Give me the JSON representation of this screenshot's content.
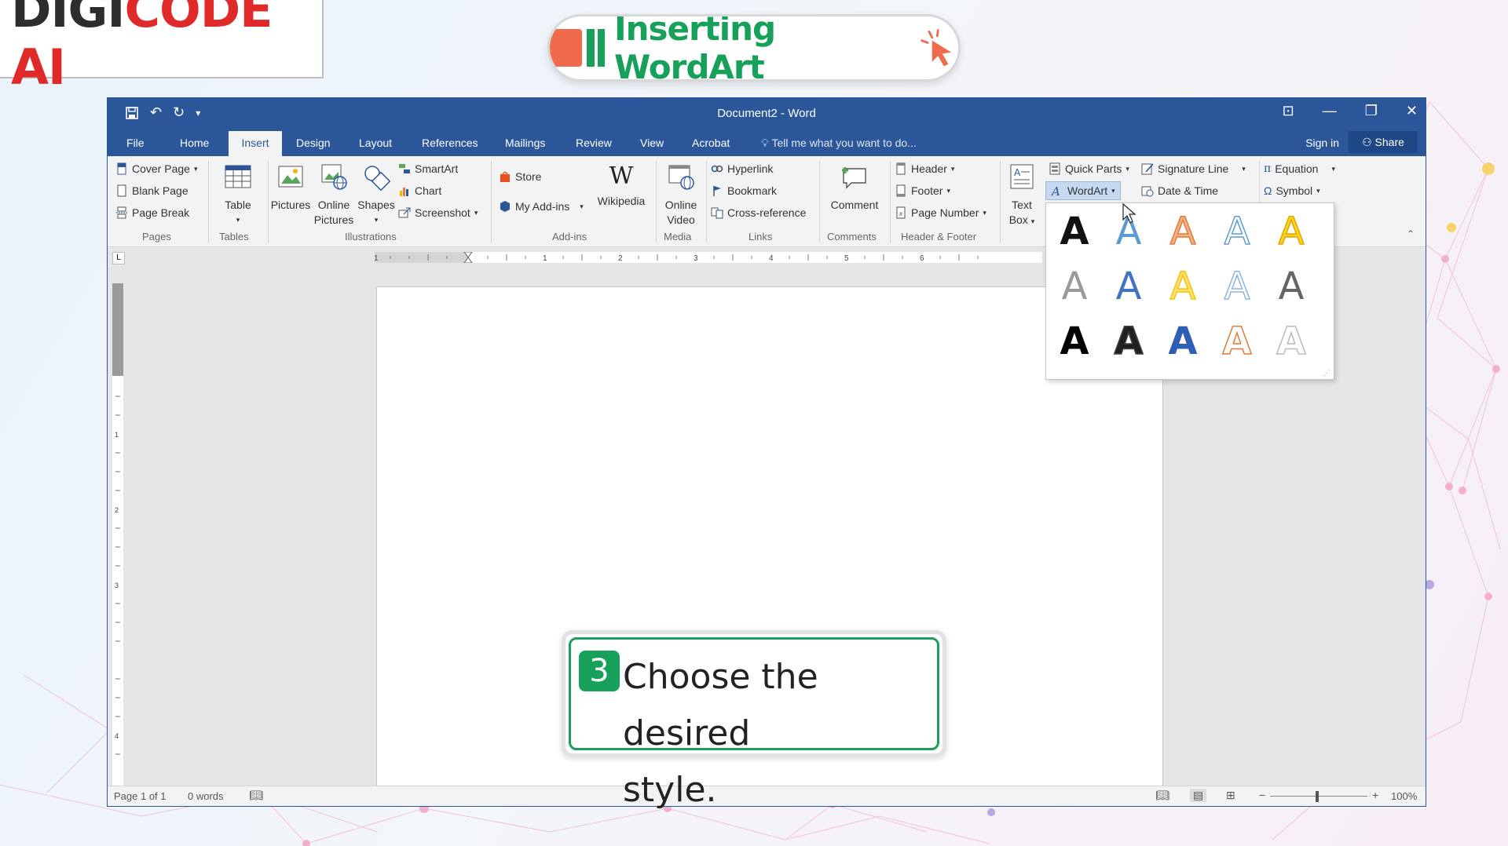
{
  "brand": {
    "part1": "DIGI",
    "part2": "CODE AI"
  },
  "lesson_title": "Inserting WordArt",
  "window": {
    "title": "Document2 - Word",
    "qat_icons": [
      "save-icon",
      "undo-icon",
      "redo-icon",
      "customize-qat-icon"
    ],
    "controls": [
      "ribbon-display-icon",
      "minimize-icon",
      "restore-icon",
      "close-icon"
    ]
  },
  "tabs": {
    "file": "File",
    "home": "Home",
    "insert": "Insert",
    "design": "Design",
    "layout": "Layout",
    "references": "References",
    "mailings": "Mailings",
    "review": "Review",
    "view": "View",
    "acrobat": "Acrobat"
  },
  "tell_me": "Tell me what you want to do...",
  "sign_in": "Sign in",
  "share": "Share",
  "ribbon": {
    "pages": {
      "cover_page": "Cover Page",
      "blank_page": "Blank Page",
      "page_break": "Page Break",
      "label": "Pages"
    },
    "tables": {
      "table": "Table",
      "label": "Tables"
    },
    "illustrations": {
      "pictures": "Pictures",
      "online1": "Online",
      "online2": "Pictures",
      "shapes": "Shapes",
      "smartart": "SmartArt",
      "chart": "Chart",
      "screenshot": "Screenshot",
      "label": "Illustrations"
    },
    "addins": {
      "store": "Store",
      "my_addins": "My Add-ins",
      "wikipedia": "Wikipedia",
      "label": "Add-ins"
    },
    "media": {
      "online": "Online",
      "video": "Video",
      "label": "Media"
    },
    "links": {
      "hyperlink": "Hyperlink",
      "bookmark": "Bookmark",
      "crossref": "Cross-reference",
      "label": "Links"
    },
    "comments": {
      "comment": "Comment",
      "label": "Comments"
    },
    "header_footer": {
      "header": "Header",
      "footer": "Footer",
      "page_number": "Page Number",
      "label": "Header & Footer"
    },
    "text": {
      "text": "Text",
      "box": "Box",
      "quick_parts": "Quick Parts",
      "wordart": "WordArt",
      "signature_line": "Signature Line",
      "date_time": "Date & Time"
    },
    "symbols": {
      "equation": "Equation",
      "symbol": "Symbol"
    }
  },
  "ruler_numbers": [
    "1",
    "1",
    "2",
    "3",
    "4",
    "5",
    "6"
  ],
  "ruler_v_numbers": [
    "1",
    "2",
    "3",
    "4"
  ],
  "wordart_gallery": {
    "glyph": "A",
    "styles": [
      {
        "fill": "#111111",
        "stroke": "none"
      },
      {
        "fill": "#5b9bd5",
        "stroke": "none"
      },
      {
        "fill": "#f4b183",
        "stroke": "#e07b3c"
      },
      {
        "fill": "#ffffff",
        "stroke": "#5b9bd5"
      },
      {
        "fill": "#ffd21f",
        "stroke": "#e0a800"
      },
      {
        "fill": "#9a9a9a",
        "stroke": "none"
      },
      {
        "fill": "#4472c4",
        "stroke": "none"
      },
      {
        "fill": "#ffe07a",
        "stroke": "#f5c400"
      },
      {
        "fill": "#ffffff",
        "stroke": "#8db4e2"
      },
      {
        "fill": "#666666",
        "stroke": "none"
      },
      {
        "fill": "#000000",
        "stroke": "none"
      },
      {
        "fill": "#1f1f1f",
        "stroke": "#444444"
      },
      {
        "fill": "#2e5fb5",
        "stroke": "none"
      },
      {
        "fill": "#ffffff",
        "stroke": "#e07b3c"
      },
      {
        "fill": "#ffffff",
        "stroke": "#bbbbbb"
      }
    ]
  },
  "callout": {
    "step": "3",
    "line1": "Choose the desired",
    "line2": "style."
  },
  "status": {
    "page": "Page 1 of 1",
    "words": "0 words",
    "zoom": "100%"
  },
  "colors": {
    "word_blue": "#2b579a",
    "brand_red": "#e02a2a",
    "accent_green": "#17a05a"
  }
}
